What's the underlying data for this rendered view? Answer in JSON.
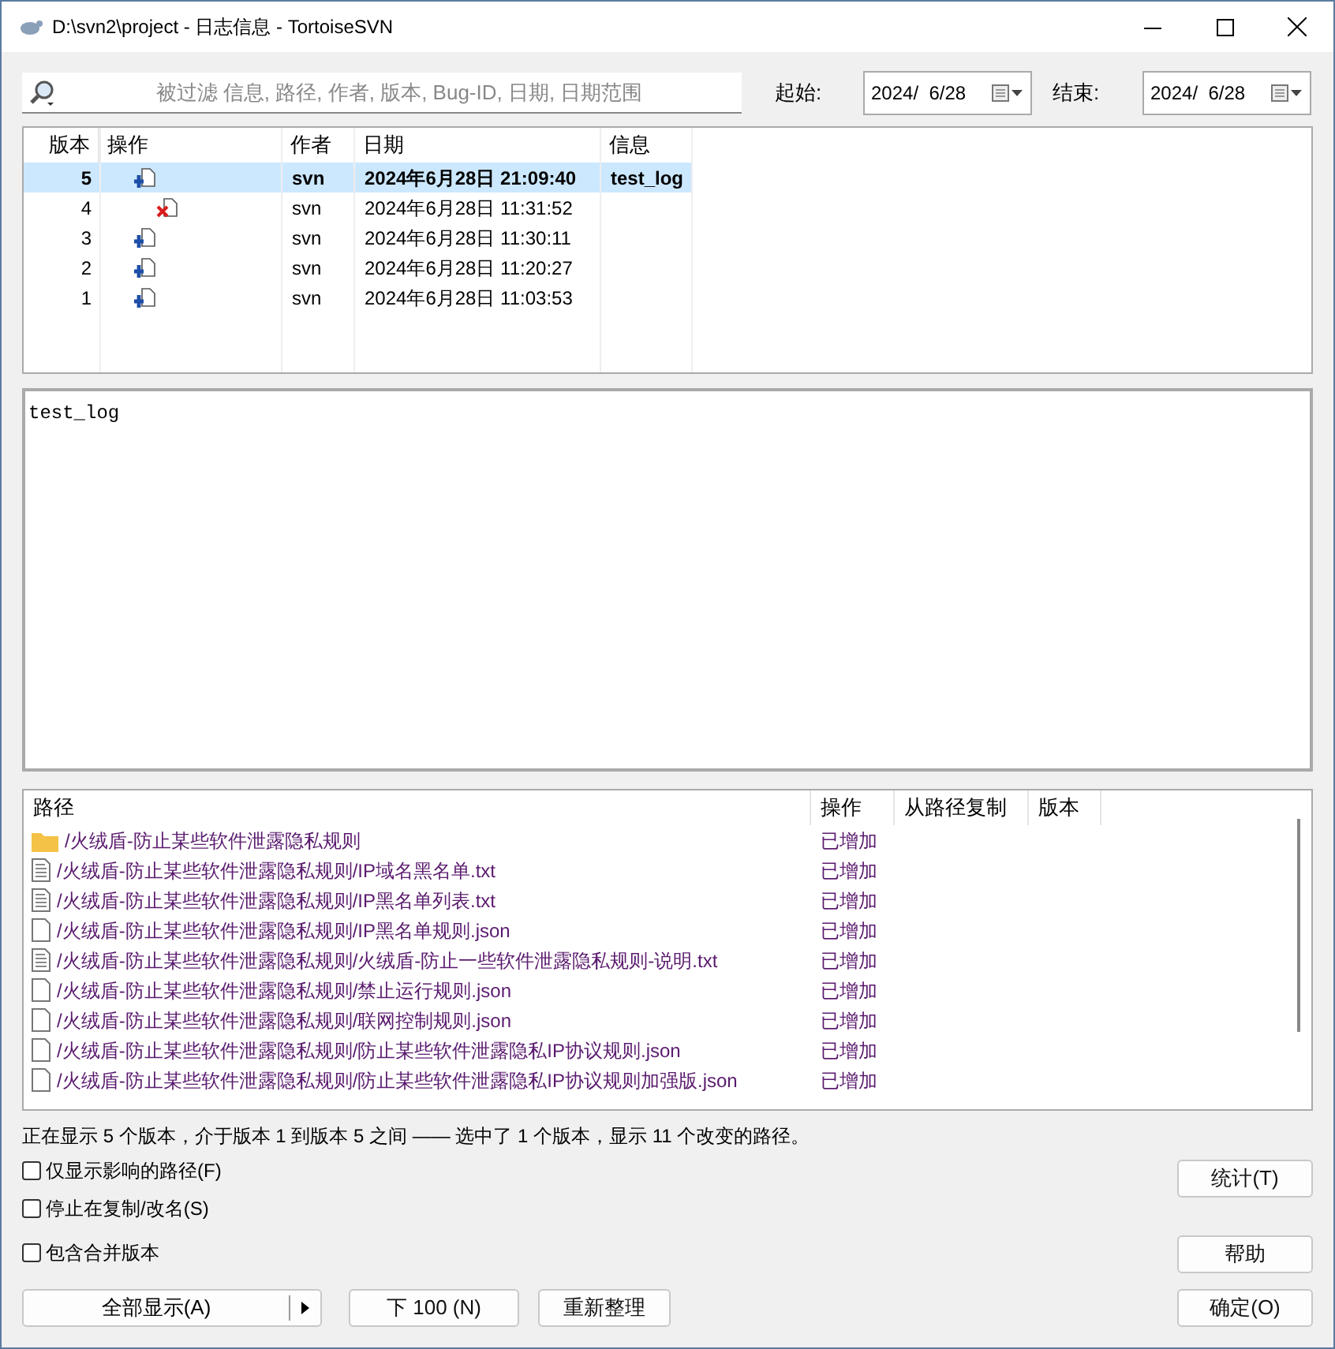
{
  "window": {
    "title": "D:\\svn2\\project - 日志信息 - TortoiseSVN"
  },
  "filter": {
    "placeholder": "被过滤 信息, 路径, 作者, 版本, Bug-ID, 日期, 日期范围",
    "from_label": "起始:",
    "from_value": "2024/  6/28",
    "to_label": "结束:",
    "to_value": "2024/  6/28"
  },
  "log": {
    "columns": [
      "版本",
      "操作",
      "作者",
      "日期",
      "信息"
    ],
    "rows": [
      {
        "revision": "5",
        "kind": "added",
        "author": "svn",
        "date": "2024年6月28日 21:09:40",
        "message": "test_log",
        "selected": true
      },
      {
        "revision": "4",
        "kind": "deleted",
        "author": "svn",
        "date": "2024年6月28日 11:31:52",
        "message": "",
        "selected": false
      },
      {
        "revision": "3",
        "kind": "added",
        "author": "svn",
        "date": "2024年6月28日 11:30:11",
        "message": "",
        "selected": false
      },
      {
        "revision": "2",
        "kind": "added",
        "author": "svn",
        "date": "2024年6月28日 11:20:27",
        "message": "",
        "selected": false
      },
      {
        "revision": "1",
        "kind": "added",
        "author": "svn",
        "date": "2024年6月28日 11:03:53",
        "message": "",
        "selected": false
      }
    ]
  },
  "message_text": "test_log",
  "paths": {
    "columns": [
      "路径",
      "操作",
      "从路径复制",
      "版本"
    ],
    "rows": [
      {
        "kind": "folder",
        "path": "/火绒盾-防止某些软件泄露隐私规则",
        "action": "已增加"
      },
      {
        "kind": "text",
        "path": "/火绒盾-防止某些软件泄露隐私规则/IP域名黑名单.txt",
        "action": "已增加"
      },
      {
        "kind": "text",
        "path": "/火绒盾-防止某些软件泄露隐私规则/IP黑名单列表.txt",
        "action": "已增加"
      },
      {
        "kind": "file",
        "path": "/火绒盾-防止某些软件泄露隐私规则/IP黑名单规则.json",
        "action": "已增加"
      },
      {
        "kind": "text",
        "path": "/火绒盾-防止某些软件泄露隐私规则/火绒盾-防止一些软件泄露隐私规则-说明.txt",
        "action": "已增加"
      },
      {
        "kind": "file",
        "path": "/火绒盾-防止某些软件泄露隐私规则/禁止运行规则.json",
        "action": "已增加"
      },
      {
        "kind": "file",
        "path": "/火绒盾-防止某些软件泄露隐私规则/联网控制规则.json",
        "action": "已增加"
      },
      {
        "kind": "file",
        "path": "/火绒盾-防止某些软件泄露隐私规则/防止某些软件泄露隐私IP协议规则.json",
        "action": "已增加"
      },
      {
        "kind": "file",
        "path": "/火绒盾-防止某些软件泄露隐私规则/防止某些软件泄露隐私IP协议规则加强版.json",
        "action": "已增加"
      }
    ]
  },
  "status": "正在显示 5 个版本，介于版本 1 到版本 5 之间 —— 选中了 1 个版本，显示 11 个改变的路径。",
  "options": [
    {
      "label": "仅显示影响的路径(F)",
      "checked": false
    },
    {
      "label": "停止在复制/改名(S)",
      "checked": false
    },
    {
      "label": "包含合并版本",
      "checked": false
    }
  ],
  "buttons": {
    "stats": "统计(T)",
    "help": "帮助",
    "show_all": "全部显示(A)",
    "next": "下 100 (N)",
    "refresh": "重新整理",
    "ok": "确定(O)"
  }
}
